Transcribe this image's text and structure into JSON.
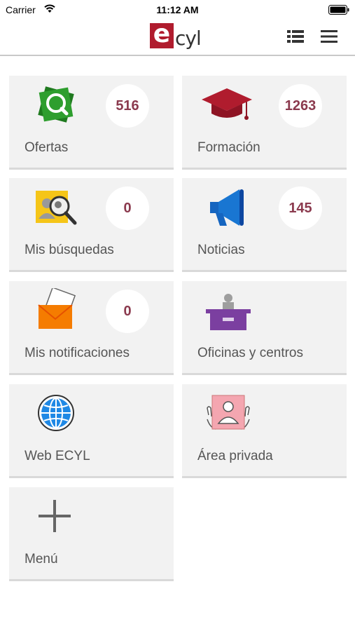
{
  "status_bar": {
    "carrier": "Carrier",
    "time": "11:12 AM"
  },
  "header": {
    "logo_letter": "e",
    "logo_text": "cyl",
    "icons": [
      "list-icon",
      "menu-icon"
    ]
  },
  "colors": {
    "brand": "#b01c2e",
    "badge_text": "#8b3a4e",
    "tile_bg": "#f2f2f2"
  },
  "tiles": [
    {
      "label": "Ofertas",
      "badge": "516",
      "icon": "job-search-icon"
    },
    {
      "label": "Formación",
      "badge": "1263",
      "icon": "graduation-cap-icon"
    },
    {
      "label": "Mis búsquedas",
      "badge": "0",
      "icon": "people-search-icon"
    },
    {
      "label": "Noticias",
      "badge": "145",
      "icon": "megaphone-icon"
    },
    {
      "label": "Mis notificaciones",
      "badge": "0",
      "icon": "envelope-icon"
    },
    {
      "label": "Oficinas y centros",
      "badge": "",
      "icon": "office-desk-icon"
    },
    {
      "label": "Web ECYL",
      "badge": "",
      "icon": "globe-icon"
    },
    {
      "label": "Área privada",
      "badge": "",
      "icon": "private-area-icon"
    },
    {
      "label": "Menú",
      "badge": "",
      "icon": "plus-icon"
    }
  ]
}
